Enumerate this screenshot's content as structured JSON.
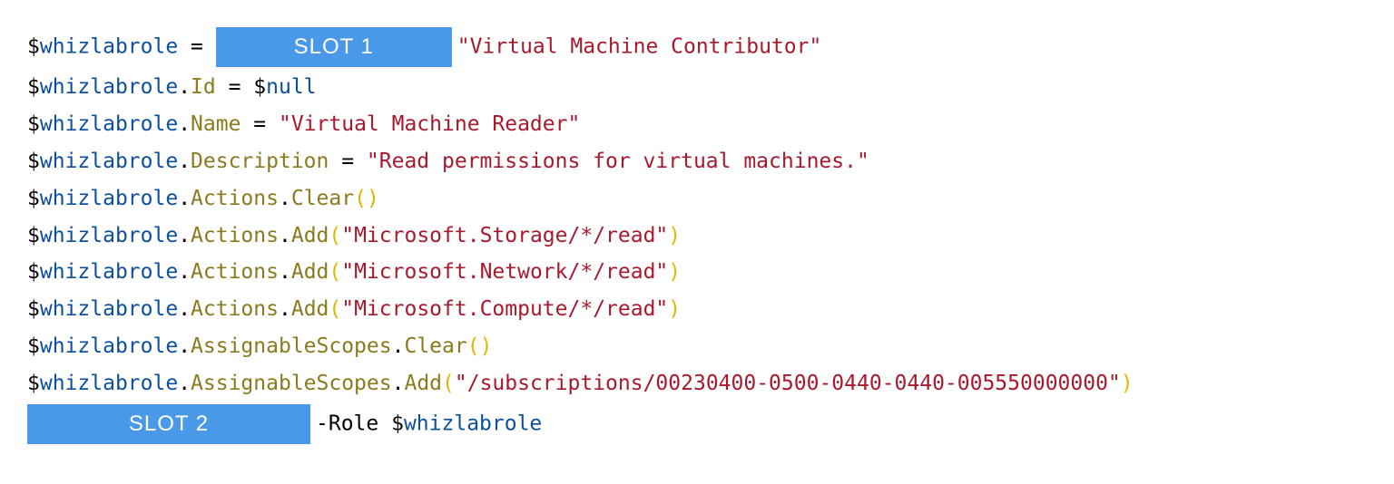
{
  "lines": {
    "l1": {
      "dollar": "$",
      "var": "whizlabrole",
      "eq": " = ",
      "slot": "SLOT 1",
      "string": "\"Virtual Machine Contributor\""
    },
    "l2": {
      "dollar": "$",
      "var": "whizlabrole",
      "dot": ".",
      "prop": "Id",
      "eq": " = ",
      "dollar2": "$",
      "null": "null"
    },
    "l3": {
      "dollar": "$",
      "var": "whizlabrole",
      "dot": ".",
      "prop": "Name",
      "eq": " = ",
      "string": "\"Virtual Machine Reader\""
    },
    "l4": {
      "dollar": "$",
      "var": "whizlabrole",
      "dot": ".",
      "prop": "Description",
      "eq": " = ",
      "string": "\"Read permissions for virtual machines.\""
    },
    "l5": {
      "dollar": "$",
      "var": "whizlabrole",
      "dot1": ".",
      "prop1": "Actions",
      "dot2": ".",
      "prop2": "Clear",
      "open": "(",
      "close": ")"
    },
    "l6": {
      "dollar": "$",
      "var": "whizlabrole",
      "dot1": ".",
      "prop1": "Actions",
      "dot2": ".",
      "prop2": "Add",
      "open": "(",
      "string": "\"Microsoft.Storage/*/read\"",
      "close": ")"
    },
    "l7": {
      "dollar": "$",
      "var": "whizlabrole",
      "dot1": ".",
      "prop1": "Actions",
      "dot2": ".",
      "prop2": "Add",
      "open": "(",
      "string": "\"Microsoft.Network/*/read\"",
      "close": ")"
    },
    "l8": {
      "dollar": "$",
      "var": "whizlabrole",
      "dot1": ".",
      "prop1": "Actions",
      "dot2": ".",
      "prop2": "Add",
      "open": "(",
      "string": "\"Microsoft.Compute/*/read\"",
      "close": ")"
    },
    "l9": {
      "dollar": "$",
      "var": "whizlabrole",
      "dot1": ".",
      "prop1": "AssignableScopes",
      "dot2": ".",
      "prop2": "Clear",
      "open": "(",
      "close": ")"
    },
    "l10": {
      "dollar": "$",
      "var": "whizlabrole",
      "dot1": ".",
      "prop1": "AssignableScopes",
      "dot2": ".",
      "prop2": "Add",
      "open": "(",
      "string": "\"/subscriptions/00230400-0500-0440-0440-005550000000\"",
      "close": ")"
    },
    "l11": {
      "slot": "SLOT 2",
      "dash": "-Role ",
      "dollar": "$",
      "var": "whizlabrole"
    }
  }
}
